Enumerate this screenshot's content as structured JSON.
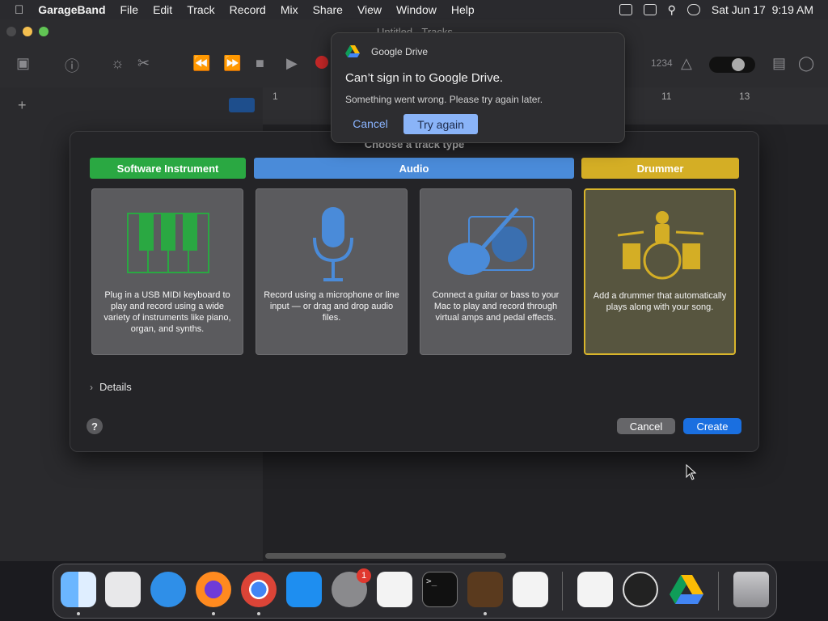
{
  "menubar": {
    "app": "GarageBand",
    "items": [
      "File",
      "Edit",
      "Track",
      "Record",
      "Mix",
      "Share",
      "View",
      "Window",
      "Help"
    ],
    "datetime": "Sat Jun 17  9:19 AM"
  },
  "window": {
    "title": "Untitled - Tracks",
    "ruler_marks": [
      "1",
      "11",
      "13"
    ],
    "lcd": "1234"
  },
  "dialog": {
    "title": "Choose a track type",
    "categories": [
      {
        "label": "Software Instrument",
        "color": "#2aa842"
      },
      {
        "label": "Audio",
        "color": "#4a8bd9"
      },
      {
        "label": "Drummer",
        "color": "#d4ae25"
      }
    ],
    "cards": [
      {
        "icon": "keyboard-icon",
        "desc": "Plug in a USB MIDI keyboard to play and record using a wide variety of instruments like piano, organ, and synths."
      },
      {
        "icon": "microphone-icon",
        "desc": "Record using a microphone or line input — or drag and drop audio files."
      },
      {
        "icon": "guitar-amp-icon",
        "desc": "Connect a guitar or bass to your Mac to play and record through virtual amps and pedal effects."
      },
      {
        "icon": "drummer-icon",
        "desc": "Add a drummer that automatically plays along with your song.",
        "selected": true
      }
    ],
    "details_label": "Details",
    "help_label": "?",
    "cancel_label": "Cancel",
    "create_label": "Create"
  },
  "notification": {
    "app": "Google Drive",
    "title": "Can’t sign in to Google Drive.",
    "body": "Something went wrong. Please try again later.",
    "cancel_label": "Cancel",
    "retry_label": "Try again"
  },
  "dock": {
    "apps": [
      "Finder",
      "Launchpad",
      "Safari",
      "Firefox",
      "Chrome",
      "App Store",
      "System Preferences",
      "TextEdit",
      "Terminal",
      "GarageBand",
      "Visual Studio Code",
      "Visual Studio",
      "OBS",
      "Google Drive",
      "Trash"
    ],
    "badge": "1"
  },
  "colors": {
    "accent": "#1a6fe0",
    "drummer_border": "#d9b52b"
  }
}
